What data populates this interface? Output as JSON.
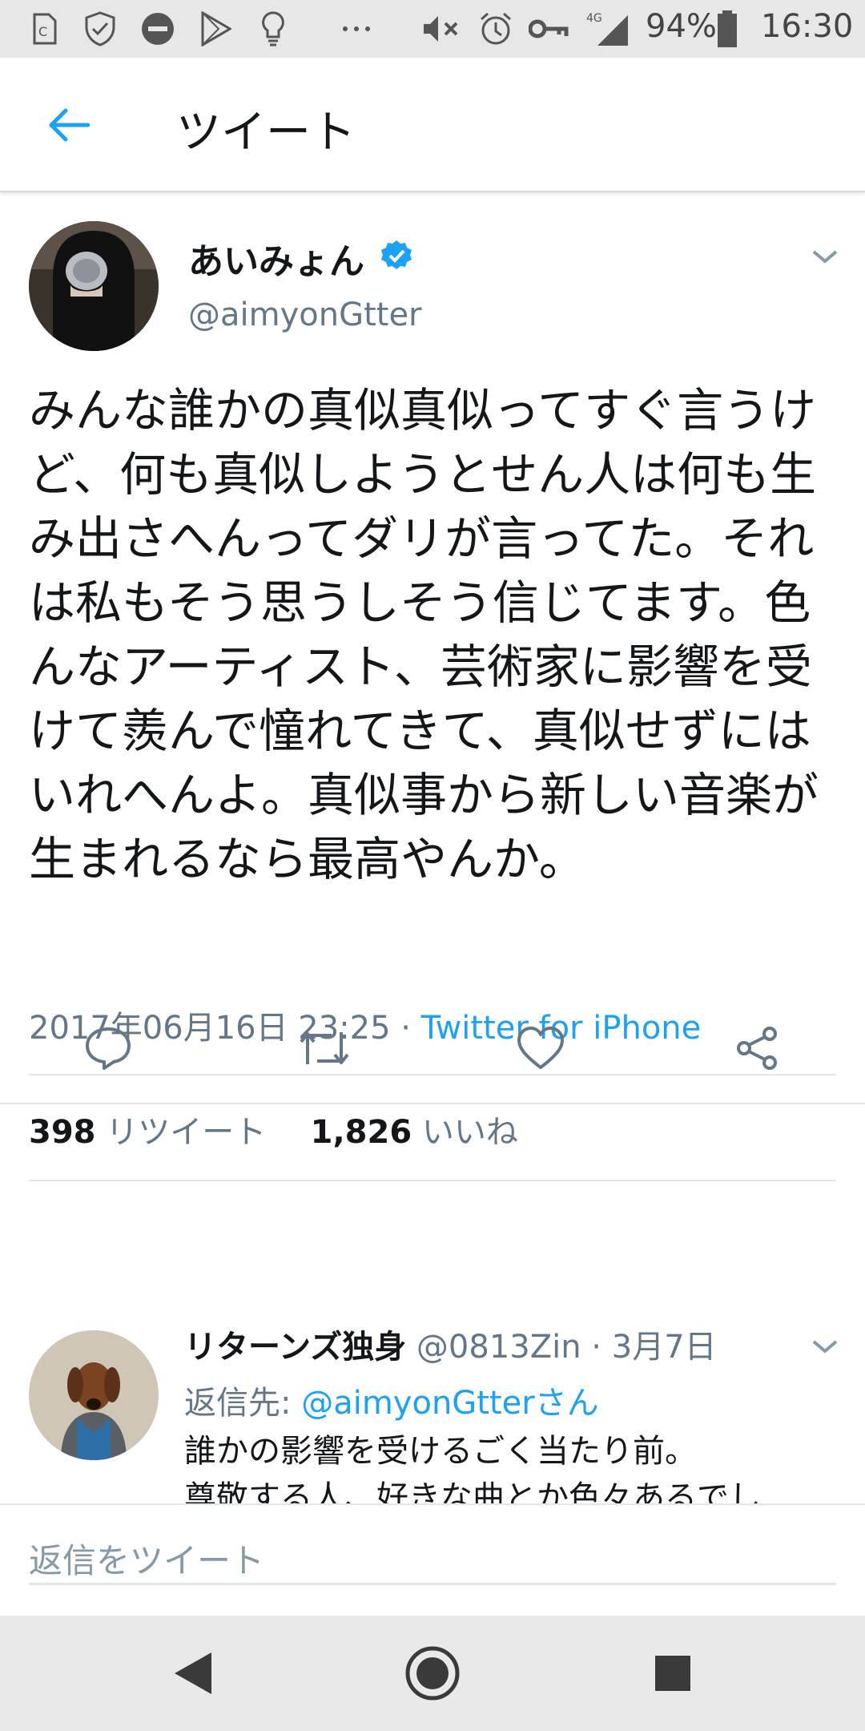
{
  "status_bar": {
    "signal_label": "4G",
    "battery_percent": "94%",
    "time": "16:30",
    "icons": [
      "sim-icon",
      "shield-check-icon",
      "do-not-disturb-icon",
      "play-store-icon",
      "bulb-icon",
      "more-dots-icon",
      "mute-icon",
      "alarm-icon",
      "key-icon",
      "signal-icon",
      "battery-icon"
    ]
  },
  "header": {
    "title": "ツイート"
  },
  "tweet": {
    "display_name": "あいみょん",
    "handle": "@aimyonGtter",
    "text": "みんな誰かの真似真似ってすぐ言うけど、何も真似しようとせん人は何も生み出さへんってダリが言ってた。それは私もそう思うしそう信じてます。色んなアーティスト、芸術家に影響を受けて羨んで憧れてきて、真似せずにはいれへんよ。真似事から新しい音楽が生まれるなら最高やんか。",
    "timestamp": "2017年06月16日 23:25",
    "separator": " · ",
    "source": "Twitter for iPhone",
    "retweets": "398",
    "retweets_label": "リツイート",
    "likes": "1,826",
    "likes_label": "いいね"
  },
  "reply": {
    "display_name": "リターンズ独身",
    "handle": "@0813Zin",
    "date": "3月7日",
    "date_separator": " · ",
    "reply_to_label": "返信先: ",
    "reply_to_mention": "@aimyonGtterさん",
    "text_line1": "誰かの影響を受けるごく当たり前。",
    "text_line2": "尊敬する人、好きな曲とか色々あるでし"
  },
  "compose": {
    "placeholder": "返信をツイート"
  },
  "colors": {
    "accent": "#1da1f2",
    "secondary_text": "#657786",
    "primary_text": "#14171a"
  }
}
